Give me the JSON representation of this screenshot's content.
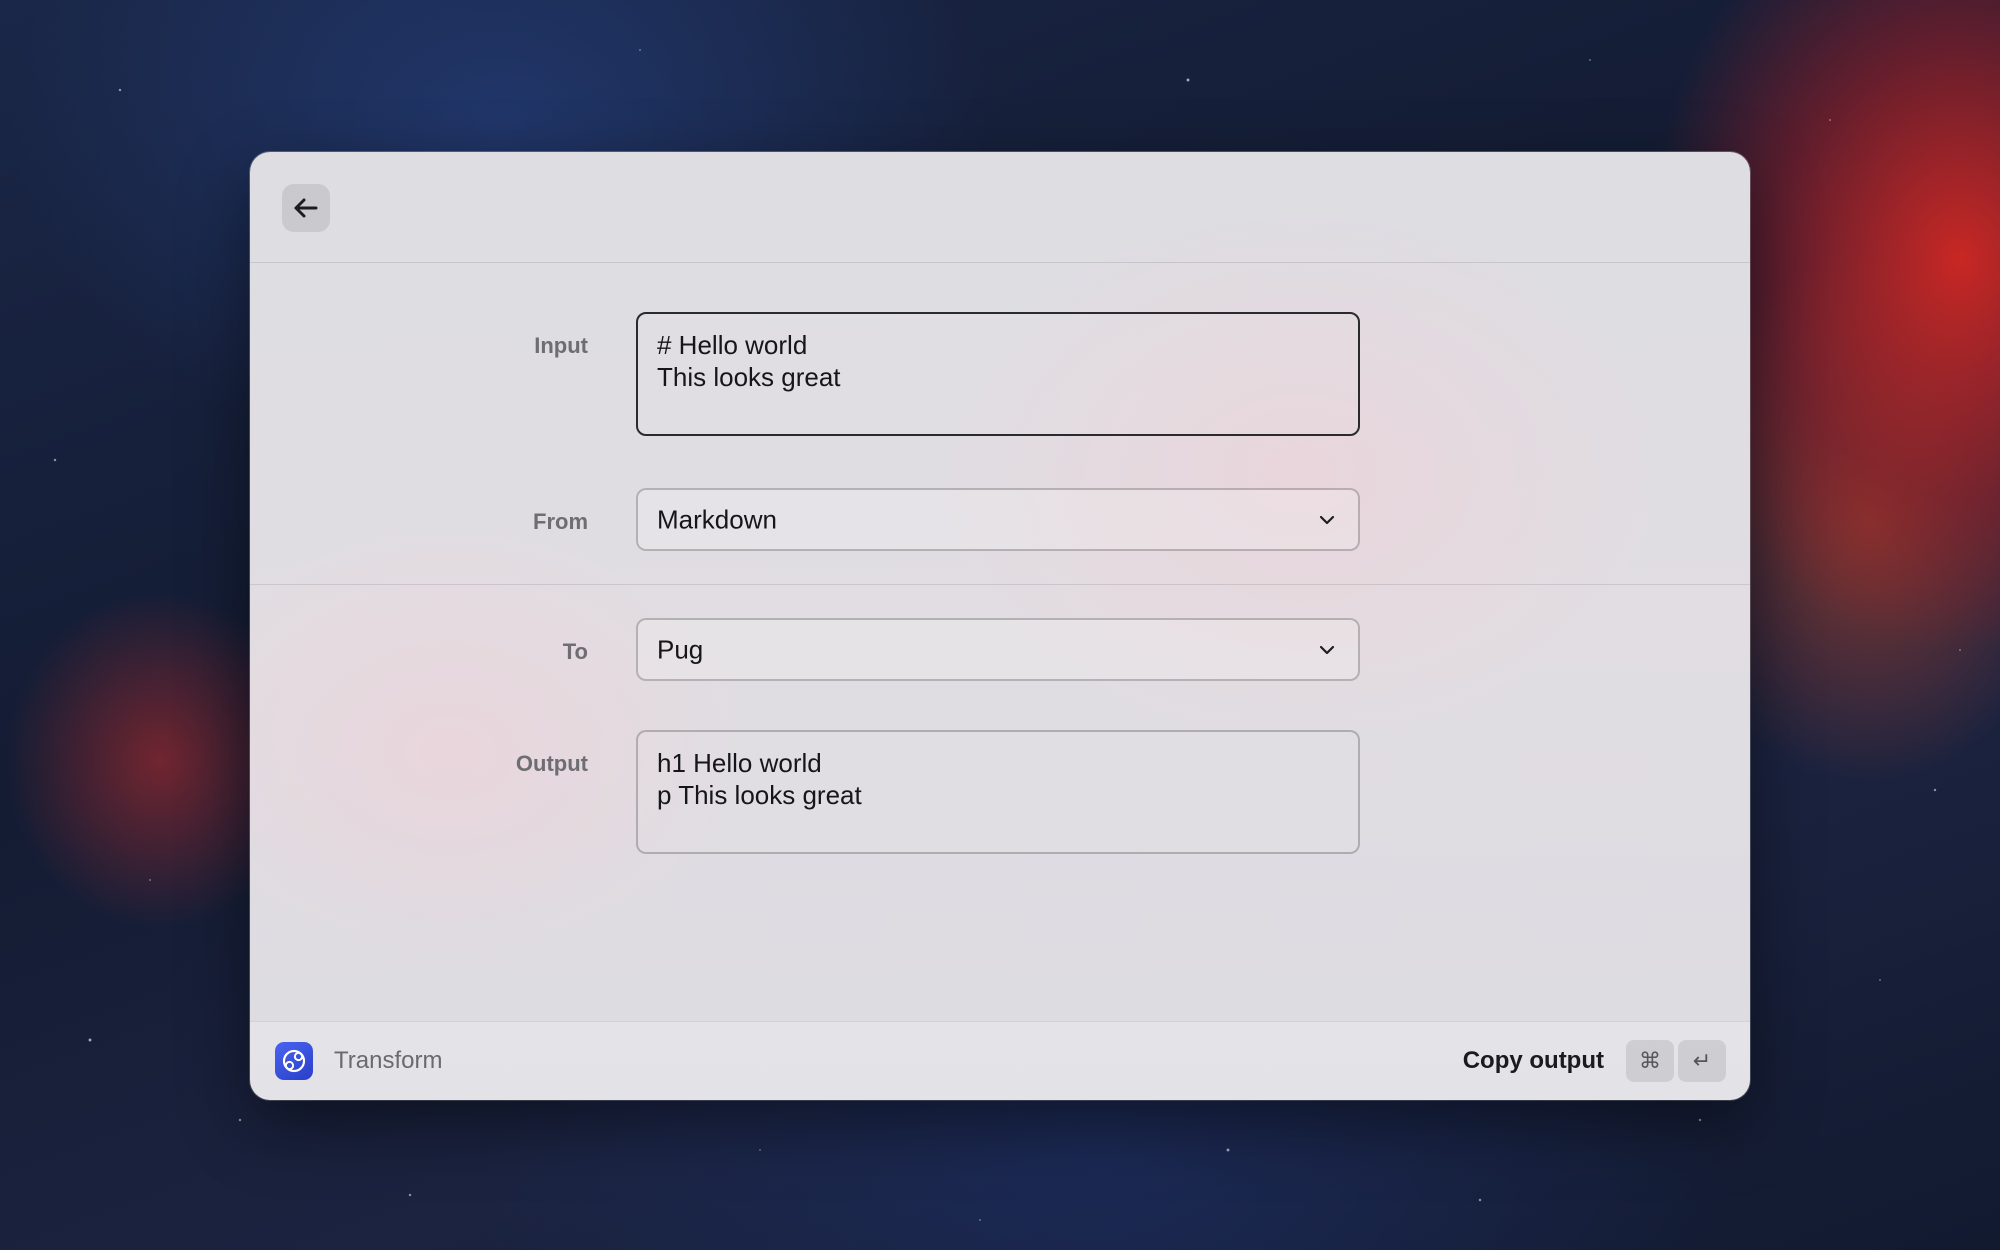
{
  "header": {
    "back_icon": "arrow-left-icon"
  },
  "form": {
    "input": {
      "label": "Input",
      "lines": [
        "# Hello world",
        "This looks great"
      ]
    },
    "from": {
      "label": "From",
      "value": "Markdown"
    },
    "to": {
      "label": "To",
      "value": "Pug"
    },
    "output": {
      "label": "Output",
      "lines": [
        "h1 Hello world",
        "p This looks great"
      ]
    }
  },
  "footer": {
    "app_name": "Transform",
    "app_icon": "transform-app-icon",
    "primary_action": "Copy output",
    "shortcut": {
      "modifier": "⌘",
      "key": "↵"
    }
  },
  "colors": {
    "app_icon_accent": "#3550e0",
    "focus_border": "#2b2b2e"
  }
}
